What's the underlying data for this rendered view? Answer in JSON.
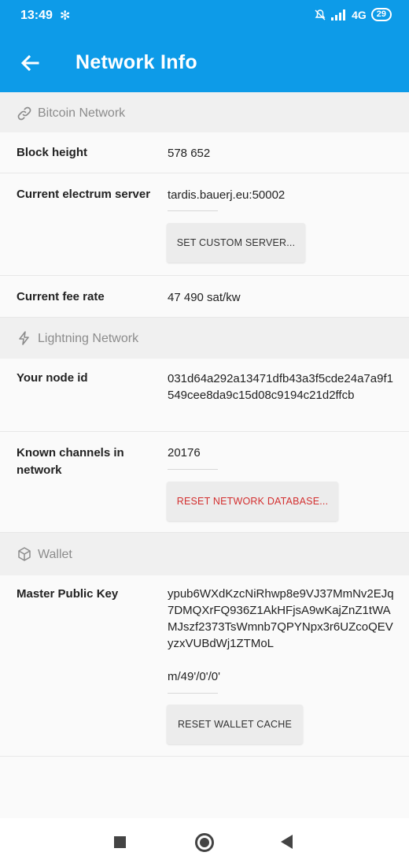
{
  "status_bar": {
    "time": "13:49",
    "network": "4G",
    "battery": "29"
  },
  "appbar": {
    "title": "Network Info"
  },
  "bitcoin": {
    "header": "Bitcoin Network",
    "block_height_label": "Block height",
    "block_height_value": "578 652",
    "server_label": "Current electrum server",
    "server_value": "tardis.bauerj.eu:50002",
    "custom_server_button": "SET CUSTOM SERVER...",
    "fee_label": "Current fee rate",
    "fee_value": "47 490 sat/kw"
  },
  "lightning": {
    "header": "Lightning Network",
    "node_id_label": "Your node id",
    "node_id_value": "031d64a292a13471dfb43a3f5cde24a7a9f1549cee8da9c15d08c9194c21d2ffcb",
    "channels_label": "Known channels in network",
    "channels_value": "20176",
    "reset_db_button": "RESET NETWORK DATABASE..."
  },
  "wallet": {
    "header": "Wallet",
    "mpk_label": "Master Public Key",
    "mpk_value": "ypub6WXdKzcNiRhwp8e9VJ37MmNv2EJq7DMQXrFQ936Z1AkHFjsA9wKajZnZ1tWAMJszf2373TsWmnb7QPYNpx3r6UZcoQEVyzxVUBdWj1ZTMoL",
    "derivation": "m/49'/0'/0'",
    "reset_cache_button": "RESET WALLET CACHE"
  },
  "colors": {
    "primary": "#0d9be8",
    "danger": "#d32f2f"
  }
}
